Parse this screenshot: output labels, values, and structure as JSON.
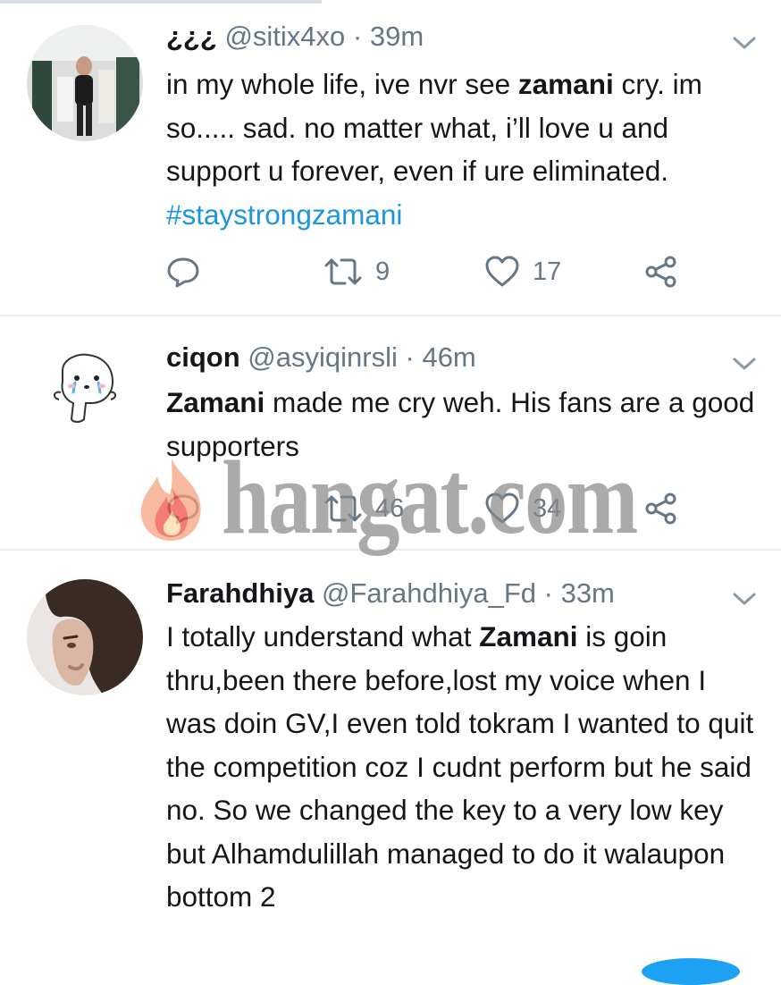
{
  "tweets": [
    {
      "display_name": "¿¿¿",
      "handle": "@sitix4xo",
      "time": "39m",
      "body_segments": [
        {
          "text": "in my whole life, ive nvr see ",
          "style": "normal"
        },
        {
          "text": "zamani",
          "style": "bold"
        },
        {
          "text": " cry. im so..... sad. no matter what, i’ll love u and support u forever, even if ure eliminated. ",
          "style": "normal"
        },
        {
          "text": "#staystrongzamani",
          "style": "hashtag"
        }
      ],
      "reply_count": "",
      "retweet_count": "9",
      "like_count": "17"
    },
    {
      "display_name": "ciqon",
      "handle": "@asyiqinrsli",
      "time": "46m",
      "body_segments": [
        {
          "text": "Zamani",
          "style": "bold"
        },
        {
          "text": " made me cry weh. His fans are a good supporters",
          "style": "normal"
        }
      ],
      "reply_count": "",
      "retweet_count": "46",
      "like_count": "34"
    },
    {
      "display_name": "Farahdhiya",
      "handle": "@Farahdhiya_Fd",
      "time": "33m",
      "body_segments": [
        {
          "text": "I totally understand what ",
          "style": "normal"
        },
        {
          "text": "Zamani",
          "style": "bold"
        },
        {
          "text": " is goin thru,been there before,lost my voice when I was doin GV,I even told tokram I wanted to quit the competition coz I cudnt perform but he said no. So we changed the key to a very low key but Alhamdulillah managed to do it walaupon bottom 2",
          "style": "normal"
        }
      ]
    }
  ],
  "separator": "·",
  "watermark": {
    "text": "hangat.com",
    "color": "#8a8a8a"
  },
  "colors": {
    "accent": "#1b95e0",
    "muted": "#657786",
    "text": "#14171a",
    "divider": "#e6ecf0"
  },
  "icons": [
    "reply-icon",
    "retweet-icon",
    "like-icon",
    "share-icon",
    "chevron-down-icon",
    "flame-logo"
  ]
}
